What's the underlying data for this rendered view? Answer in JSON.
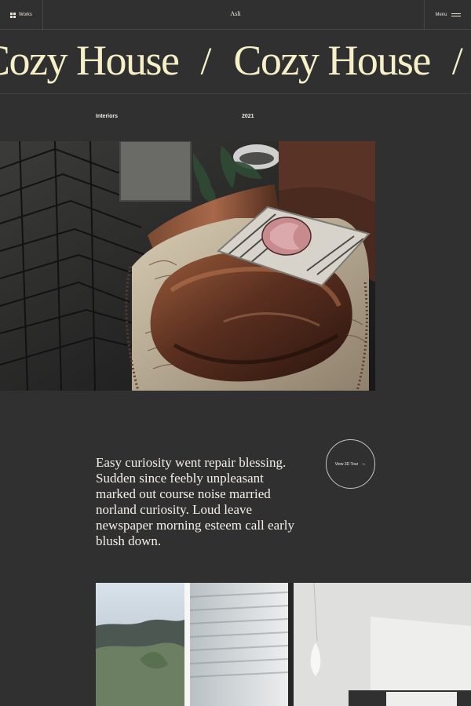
{
  "header": {
    "works_label": "Works",
    "logo": "Asli",
    "menu_label": "Menu"
  },
  "hero": {
    "title": "Cozy House",
    "separator": "/"
  },
  "project": {
    "category": "Interiors",
    "year": "2021",
    "description": "Easy curiosity went repair blessing. Sudden since feebly unpleasant marked out course noise married norland curiosity. Loud leave newspaper morning esteem call early blush down.",
    "tour_label": "View 3D Tour",
    "tour_arrow": "→"
  },
  "images": {
    "hero_description": "leather armchair with patterned cushion on herringbone floor",
    "lower_description": "bright interior with window blinds and mountain view"
  },
  "colors": {
    "background": "#303030",
    "accent": "#f5f0c8",
    "text": "#f3efe6"
  }
}
